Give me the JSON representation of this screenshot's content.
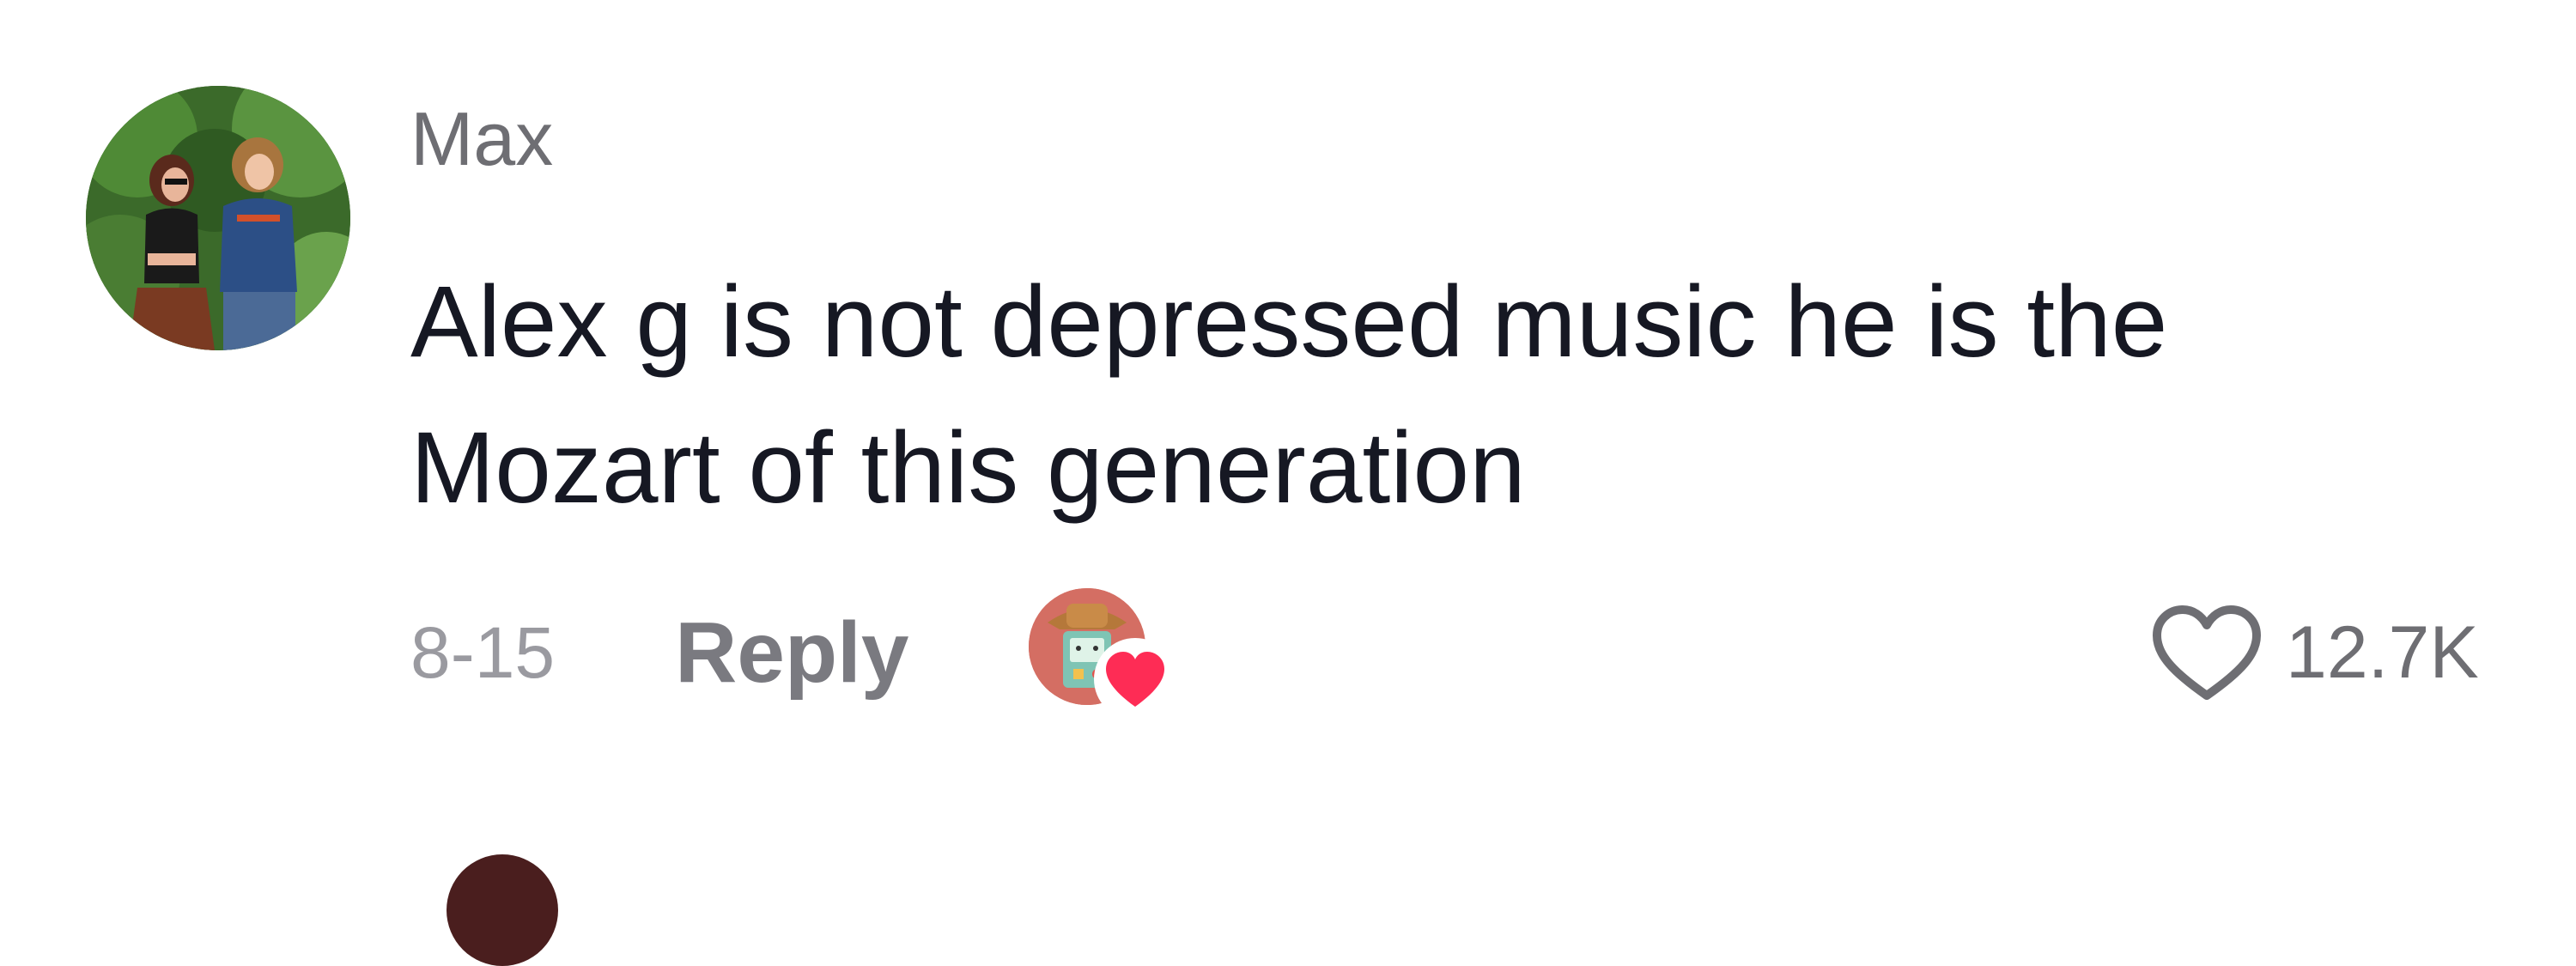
{
  "comment": {
    "username": "Max",
    "text_line1": "Alex g is not depressed music he is the",
    "text_line2": "Mozart of this generation",
    "date": "8-15",
    "reply_label": "Reply",
    "like_count": "12.7K",
    "liked_by_creator": true
  },
  "icons": {
    "like": "heart-outline-icon",
    "creator_heart": "heart-filled-icon"
  },
  "colors": {
    "text_primary": "#161823",
    "text_secondary": "#6e6e73",
    "heart_red": "#fe2c55"
  }
}
